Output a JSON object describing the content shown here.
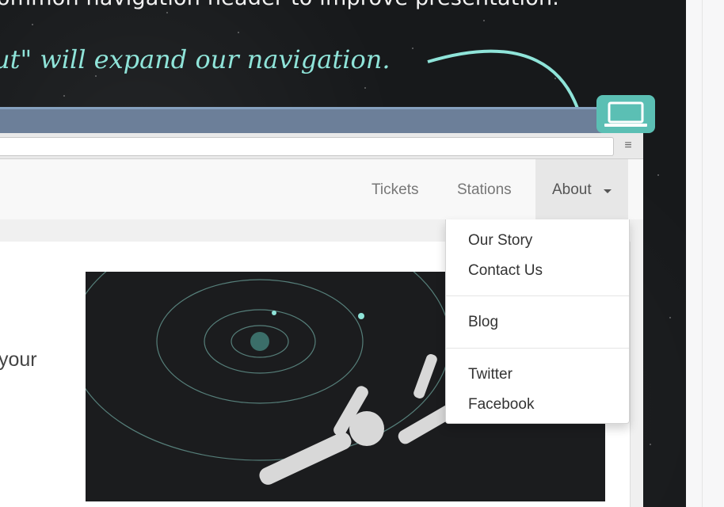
{
  "caption": {
    "top_line": "ommon navigation header to improve presentation.",
    "annotation": "ut\" will expand our navigation."
  },
  "browser": {
    "menu_icon": "hamburger-icon",
    "url_value": ""
  },
  "nav": {
    "links": [
      "Tickets",
      "Stations"
    ],
    "about_label": "About"
  },
  "dropdown": {
    "group1": [
      "Our Story",
      "Contact Us"
    ],
    "group2": [
      "Blog"
    ],
    "group3": [
      "Twitter",
      "Facebook"
    ]
  },
  "content": {
    "partial_text": "your"
  },
  "colors": {
    "annotation": "#8fe4d9",
    "accent_teal": "#5bbfb4",
    "browser_frame": "#6c7f99"
  }
}
